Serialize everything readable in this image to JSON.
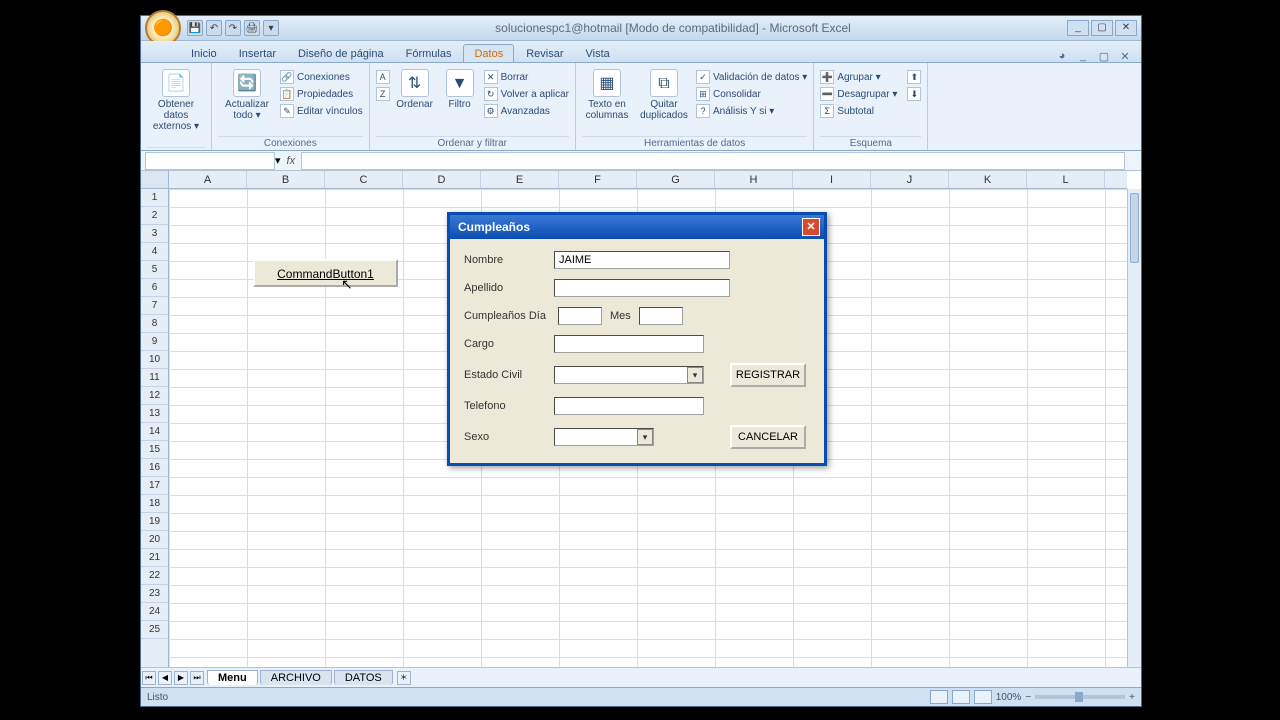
{
  "titlebar": "solucionespc1@hotmail  [Modo de compatibilidad] - Microsoft Excel",
  "menu_tabs": [
    "Inicio",
    "Insertar",
    "Diseño de página",
    "Fórmulas",
    "Datos",
    "Revisar",
    "Vista"
  ],
  "active_tab_index": 4,
  "ribbon": {
    "g1": {
      "btn": "Obtener datos externos ▾",
      "label": ""
    },
    "g2": {
      "btn": "Actualizar todo ▾",
      "items": [
        "Conexiones",
        "Propiedades",
        "Editar vínculos"
      ],
      "label": "Conexiones"
    },
    "g3": {
      "az": "A Z",
      "za": "Z A",
      "ordenar": "Ordenar",
      "filtro": "Filtro",
      "items": [
        "Borrar",
        "Volver a aplicar",
        "Avanzadas"
      ],
      "label": "Ordenar y filtrar"
    },
    "g4": {
      "btn1": "Texto en columnas",
      "btn2": "Quitar duplicados",
      "items": [
        "Validación de datos ▾",
        "Consolidar",
        "Análisis Y si ▾"
      ],
      "label": "Herramientas de datos"
    },
    "g5": {
      "items": [
        "Agrupar ▾",
        "Desagrupar ▾",
        "Subtotal"
      ],
      "label": "Esquema"
    }
  },
  "columns": [
    "A",
    "B",
    "C",
    "D",
    "E",
    "F",
    "G",
    "H",
    "I",
    "J",
    "K",
    "L"
  ],
  "row_count": 25,
  "sheet_button": "CommandButton1",
  "sheet_tabs": [
    "Menu",
    "ARCHIVO",
    "DATOS"
  ],
  "status": "Listo",
  "zoom": "100%",
  "dialog": {
    "title": "Cumpleaños",
    "labels": {
      "nombre": "Nombre",
      "apellido": "Apellido",
      "dia": "Cumpleaños Día",
      "mes": "Mes",
      "cargo": "Cargo",
      "estado": "Estado Civil",
      "telefono": "Telefono",
      "sexo": "Sexo"
    },
    "values": {
      "nombre": "JAIME",
      "apellido": "",
      "dia": "",
      "mes": "",
      "cargo": "",
      "estado": "",
      "telefono": "",
      "sexo": ""
    },
    "btn_ok": "REGISTRAR",
    "btn_cancel": "CANCELAR"
  }
}
